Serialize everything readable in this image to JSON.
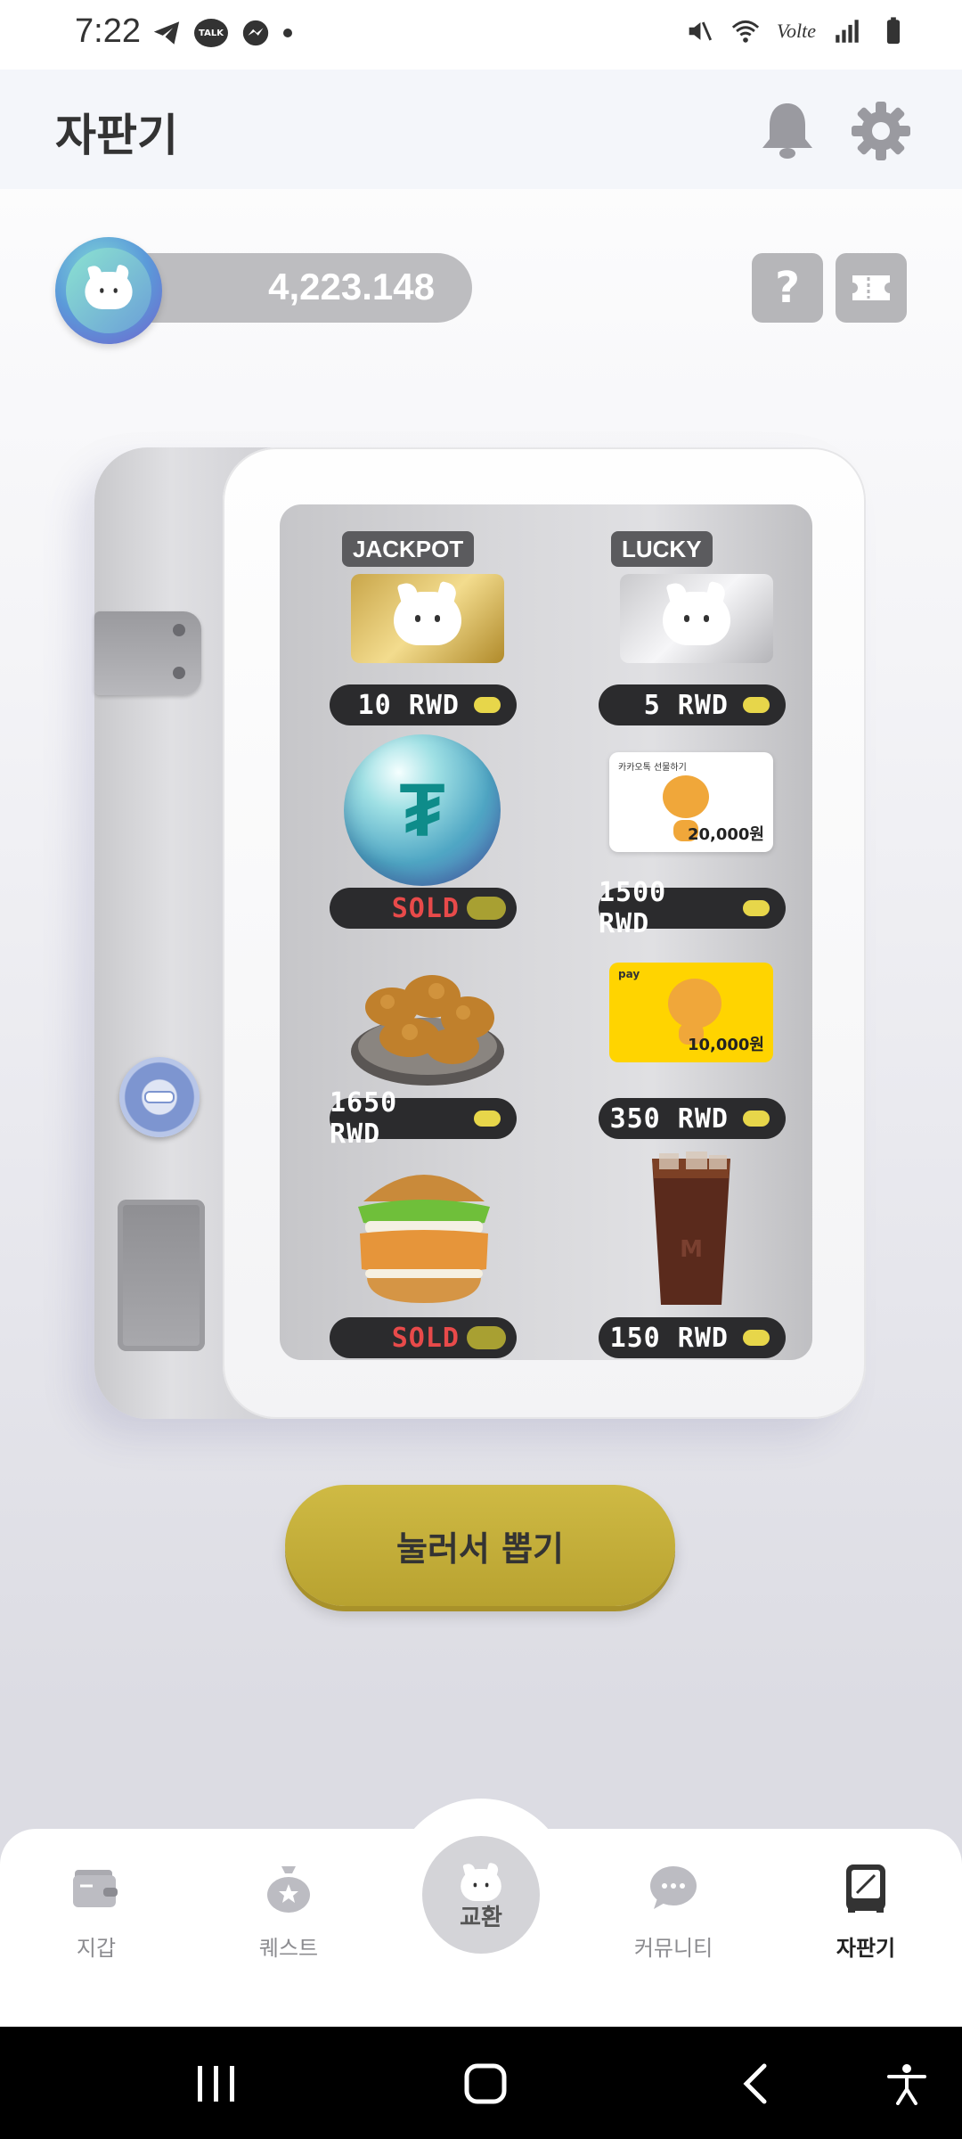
{
  "status_bar": {
    "time": "7:22",
    "talk_badge": "TALK",
    "network": "Volte"
  },
  "header": {
    "title": "자판기"
  },
  "balance": {
    "value": "4,223.148"
  },
  "help_button": {
    "label": "?"
  },
  "products": [
    {
      "tag": "JACKPOT",
      "price": "10 RWD",
      "sold": false
    },
    {
      "tag": "LUCKY",
      "price": "5 RWD",
      "sold": false
    },
    {
      "price": "SOLD",
      "sold": true
    },
    {
      "price": "1500 RWD",
      "sold": false,
      "card_label": "카카오톡 선물하기",
      "card_amount": "20,000원"
    },
    {
      "price": "1650 RWD",
      "sold": false
    },
    {
      "price": "350 RWD",
      "sold": false,
      "card_label": "pay",
      "card_amount": "10,000원"
    },
    {
      "price": "SOLD",
      "sold": true
    },
    {
      "price": "150 RWD",
      "sold": false
    }
  ],
  "draw_button": {
    "label": "눌러서 뽑기"
  },
  "bottom_nav": [
    {
      "label": "지갑",
      "icon": "wallet-icon"
    },
    {
      "label": "퀘스트",
      "icon": "quest-bag-icon"
    },
    {
      "label": "교환",
      "icon": "exchange-cat-icon"
    },
    {
      "label": "커뮤니티",
      "icon": "chat-bubble-icon"
    },
    {
      "label": "자판기",
      "icon": "vending-machine-icon",
      "active": true
    }
  ],
  "colors": {
    "accent": "#c8b33e",
    "header_bg": "#f4f6fa",
    "price_led": "#e7d64a",
    "sold_text": "#e84a4a"
  }
}
